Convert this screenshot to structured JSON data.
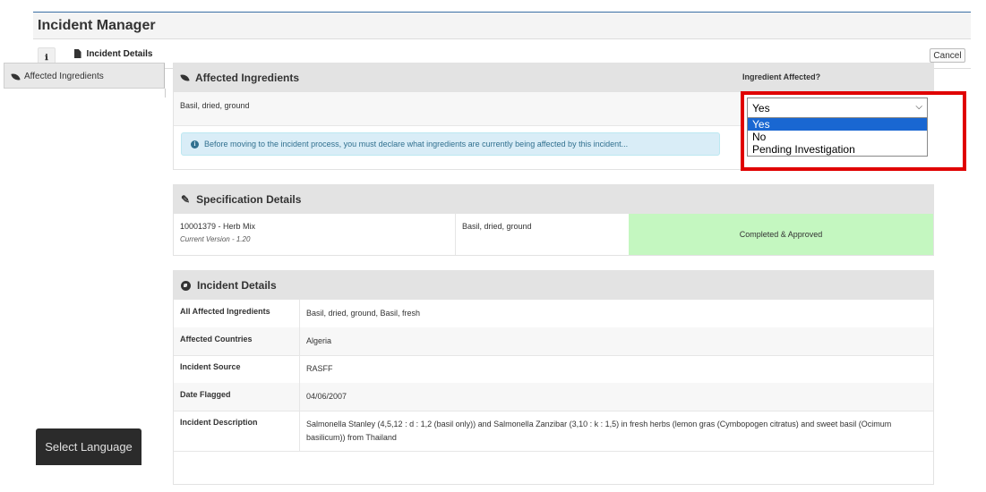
{
  "app": {
    "title": "Incident Manager"
  },
  "tabs": {
    "details_label": "Incident Details",
    "cancel_label": "Cancel"
  },
  "sidebar": {
    "items": [
      {
        "label": "Affected Ingredients"
      }
    ]
  },
  "affected_ingredients": {
    "header": "Affected Ingredients",
    "column_label": "Ingredient Affected?",
    "row_ingredient": "Basil, dried, ground",
    "info_message": "Before moving to the incident process, you must declare what ingredients are currently being affected by this incident...",
    "select": {
      "value": "Yes",
      "options": [
        "Yes",
        "No",
        "Pending Investigation"
      ],
      "selected_index": 0
    }
  },
  "specification": {
    "header": "Specification Details",
    "spec_name": "10001379 - Herb Mix",
    "version_label": "Current Version",
    "version_value": " - 1.20",
    "ingredient": "Basil, dried, ground",
    "status": "Completed & Approved"
  },
  "incident_details": {
    "header": "Incident Details",
    "rows": [
      {
        "label": "All Affected Ingredients",
        "value": "Basil, dried, ground, Basil, fresh"
      },
      {
        "label": "Affected Countries",
        "value": "Algeria"
      },
      {
        "label": "Incident Source",
        "value": "RASFF"
      },
      {
        "label": "Date Flagged",
        "value": "04/06/2007"
      },
      {
        "label": "Incident Description",
        "value": "Salmonella Stanley (4,5,12 : d : 1,2 (basil only)) and Salmonella Zanzibar (3,10 : k : 1,5) in fresh herbs (lemon gras (Cymbopogen citratus) and sweet basil (Ocimum basilicum)) from Thailand"
      }
    ]
  },
  "language": {
    "label": "Select Language"
  },
  "colors": {
    "accent": "#3a7bbf",
    "highlight_border": "#e00000",
    "approved_bg": "#c4f7c0",
    "info_bg": "#d9edf7"
  }
}
